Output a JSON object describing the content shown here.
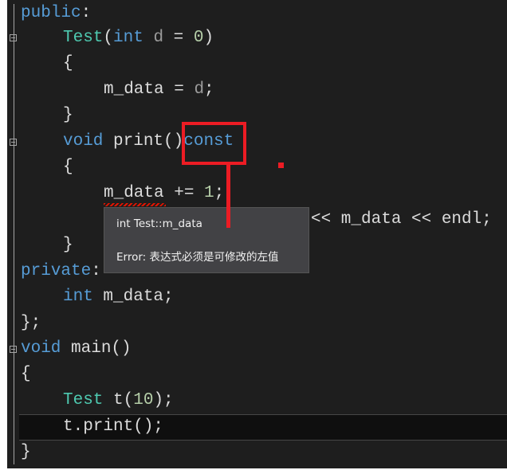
{
  "code": {
    "l1": {
      "kw": "public",
      "rest": ":"
    },
    "l2": {
      "name": "Test",
      "p1": "(",
      "kw": "int",
      "param": " d",
      "rest": " = ",
      "num": "0",
      "close": ")"
    },
    "l3": "{",
    "l4": {
      "id": "m_data",
      "rest": " = ",
      "param": "d",
      "end": ";"
    },
    "l5": "}",
    "l6": {
      "kw": "void",
      "name": " print()",
      "kw2": "const"
    },
    "l7": "{",
    "l8": {
      "id": "m_data",
      "rest": " += ",
      "num": "1",
      "end": ";"
    },
    "l9": "<< m_data << endl;",
    "l10": "}",
    "l11": {
      "kw": "private",
      "rest": ":"
    },
    "l12": {
      "kw": "int",
      "rest": " m_data;"
    },
    "l13": "};",
    "l14": {
      "kw": "void",
      "rest": " main()"
    },
    "l15": "{",
    "l16": {
      "ty": "Test",
      "rest": " t(",
      "num": "10",
      "end": ");"
    },
    "l17": "t.print();",
    "l18": "}"
  },
  "tooltip": {
    "symbol": "int Test::m_data",
    "error": "Error: 表达式必须是可修改的左值"
  },
  "colors": {
    "keyword": "#569cd6",
    "type": "#4ec9b0",
    "number": "#b5cea8",
    "annotation": "#ec1c24",
    "background": "#1e1e1e"
  }
}
